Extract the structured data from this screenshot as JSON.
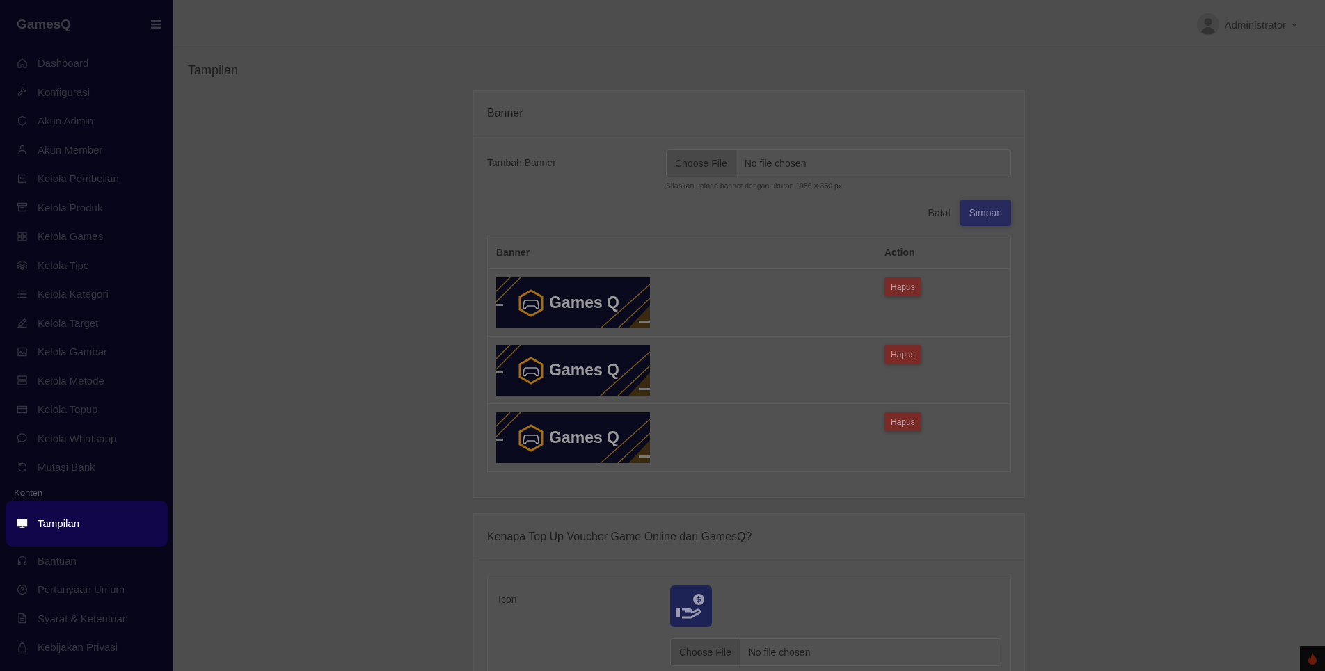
{
  "sidebar": {
    "brand": "GamesQ",
    "items": [
      {
        "kind": "link",
        "label": "Dashboard",
        "selected": false
      },
      {
        "kind": "link",
        "label": "Konfigurasi",
        "selected": false
      },
      {
        "kind": "link",
        "label": "Akun Admin",
        "selected": false
      },
      {
        "kind": "link",
        "label": "Akun Member",
        "selected": false
      },
      {
        "kind": "link",
        "label": "Kelola Pembelian",
        "selected": false
      },
      {
        "kind": "link",
        "label": "Kelola Produk",
        "selected": false
      },
      {
        "kind": "link",
        "label": "Kelola Games",
        "selected": false
      },
      {
        "kind": "link",
        "label": "Kelola Tipe",
        "selected": false
      },
      {
        "kind": "link",
        "label": "Kelola Kategori",
        "selected": false
      },
      {
        "kind": "link",
        "label": "Kelola Target",
        "selected": false
      },
      {
        "kind": "link",
        "label": "Kelola Gambar",
        "selected": false
      },
      {
        "kind": "link",
        "label": "Kelola Metode",
        "selected": false
      },
      {
        "kind": "link",
        "label": "Kelola Topup",
        "selected": false
      },
      {
        "kind": "link",
        "label": "Kelola Whatsapp",
        "selected": false
      },
      {
        "kind": "link",
        "label": "Mutasi Bank",
        "selected": false
      },
      {
        "kind": "section",
        "label": "Konten"
      },
      {
        "kind": "link",
        "label": "Tampilan",
        "selected": true
      },
      {
        "kind": "link",
        "label": "Bantuan",
        "selected": false
      },
      {
        "kind": "link",
        "label": "Pertanyaan Umum",
        "selected": false
      },
      {
        "kind": "link",
        "label": "Syarat & Ketentuan",
        "selected": false
      },
      {
        "kind": "link",
        "label": "Kebijakan Privasi",
        "selected": false
      }
    ]
  },
  "header": {
    "user": "Administrator"
  },
  "page_title": "Tampilan",
  "banner_card": {
    "title": "Banner",
    "field_label": "Tambah Banner",
    "file_button": "Choose File",
    "file_status": "No file chosen",
    "help": "Silahkan upload banner dengan ukuran 1056 × 350 px",
    "cancel": "Batal",
    "save": "Simpan",
    "table": {
      "columns": [
        "Banner",
        "Action"
      ],
      "rows": [
        {
          "banner_text": "Games Q",
          "action": "Hapus"
        },
        {
          "banner_text": "Games Q",
          "action": "Hapus"
        },
        {
          "banner_text": "Games Q",
          "action": "Hapus"
        }
      ]
    }
  },
  "why_card": {
    "title": "Kenapa Top Up Voucher Game Online dari GamesQ?",
    "field_label": "Icon",
    "file_button": "Choose File",
    "file_status": "No file chosen"
  }
}
